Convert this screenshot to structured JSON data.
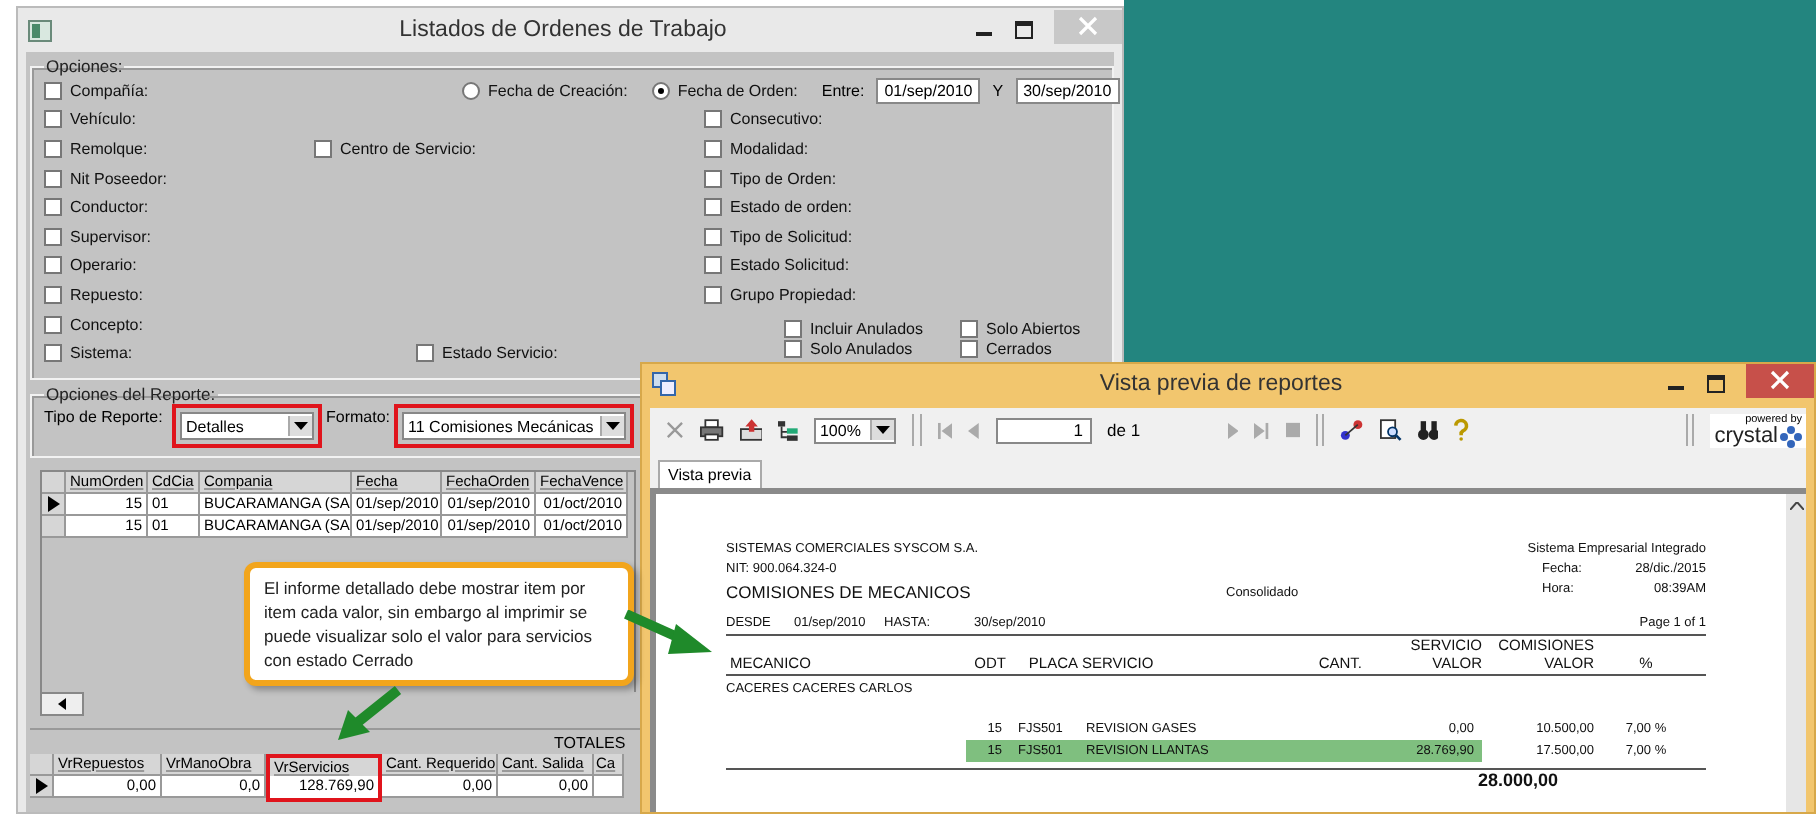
{
  "main_window": {
    "title": "Listados de Ordenes de Trabajo",
    "options": {
      "legend": "Opciones:",
      "date_filter": {
        "radios": [
          {
            "label": "Fecha de Creación:",
            "selected": false
          },
          {
            "label": "Fecha de Orden:",
            "selected": true
          }
        ],
        "between_label": "Entre:",
        "from": "01/sep/2010",
        "and_label": "Y",
        "to": "30/sep/2010"
      },
      "rows": [
        {
          "left": {
            "label": "Compañía:",
            "checked": false
          }
        },
        {
          "left": {
            "label": "Vehículo:",
            "checked": false
          },
          "right": {
            "label": "Consecutivo:",
            "checked": false
          }
        },
        {
          "left": {
            "label": "Remolque:",
            "checked": false
          },
          "middle": {
            "label": "Centro de Servicio:",
            "checked": false
          },
          "right": {
            "label": "Modalidad:",
            "checked": false
          }
        },
        {
          "left": {
            "label": "Nit Poseedor:",
            "checked": false
          },
          "right": {
            "label": "Tipo de Orden:",
            "checked": false
          }
        },
        {
          "left": {
            "label": "Conductor:",
            "checked": false
          },
          "right": {
            "label": "Estado de orden:",
            "checked": false
          }
        },
        {
          "left": {
            "label": "Supervisor:",
            "checked": false
          },
          "right": {
            "label": "Tipo de Solicitud:",
            "checked": false
          }
        },
        {
          "left": {
            "label": "Operario:",
            "checked": false
          },
          "right": {
            "label": "Estado Solicitud:",
            "checked": false
          }
        },
        {
          "left": {
            "label": "Repuesto:",
            "checked": false
          },
          "right": {
            "label": "Grupo Propiedad:",
            "checked": false
          }
        },
        {
          "left": {
            "label": "Concepto:",
            "checked": false
          }
        },
        {
          "left": {
            "label": "Sistema:",
            "checked": false
          },
          "center": {
            "label": "Estado Servicio:",
            "checked": false
          }
        }
      ],
      "status_checks": [
        {
          "label": "Incluir Anulados",
          "checked": false
        },
        {
          "label": "Solo Abiertos",
          "checked": false
        },
        {
          "label": "Solo Anulados",
          "checked": false
        },
        {
          "label": "Cerrados",
          "checked": false
        }
      ]
    },
    "report_options": {
      "legend": "Opciones del Reporte:",
      "type_label": "Tipo de Reporte:",
      "type_value": "Detalles",
      "type_highlighted": true,
      "format_label": "Formato:",
      "format_value": "11  Comisiones Mecánicas",
      "format_highlighted": true
    },
    "orders_table": {
      "columns": [
        "NumOrden",
        "CdCia",
        "Compania",
        "Fecha",
        "FechaOrden",
        "FechaVence"
      ],
      "rows": [
        {
          "current": true,
          "cells": [
            "15",
            "01",
            "BUCARAMANGA  (SA",
            "01/sep/2010",
            "01/sep/2010",
            "01/oct/2010"
          ]
        },
        {
          "current": false,
          "cells": [
            "15",
            "01",
            "BUCARAMANGA  (SA",
            "01/sep/2010",
            "01/sep/2010",
            "01/oct/2010"
          ]
        }
      ]
    },
    "totals_table": {
      "title": "TOTALES",
      "columns": [
        {
          "label": "VrRepuestos",
          "highlighted": false
        },
        {
          "label": "VrManoObra",
          "highlighted": false
        },
        {
          "label": "VrServicios",
          "highlighted": true
        },
        {
          "label": "Cant. Requerido",
          "highlighted": false
        },
        {
          "label": "Cant. Salida",
          "highlighted": false
        },
        {
          "label": "Ca",
          "highlighted": false
        }
      ],
      "rows": [
        {
          "current": true,
          "cells": [
            "0,00",
            "0,0",
            "128.769,90",
            "0,00",
            "0,00",
            ""
          ]
        }
      ]
    }
  },
  "callout": {
    "text": "El informe detallado debe mostrar item por item cada valor, sin embargo al imprimir se puede visualizar solo el valor para servicios con estado Cerrado"
  },
  "preview_window": {
    "title": "Vista previa de reportes",
    "zoom": "100%",
    "page": "1",
    "page_count": "de 1",
    "logo_caption": "powered by",
    "logo_word": "crystal",
    "tab": "Vista previa",
    "report": {
      "company": "SISTEMAS COMERCIALES SYSCOM S.A.",
      "nit": "NIT: 900.064.324-0",
      "title": "COMISIONES DE MECANICOS",
      "subtitle": "Consolidado",
      "system": "Sistema Empresarial Integrado",
      "date_label": "Fecha:",
      "date": "28/dic./2015",
      "time_label": "Hora:",
      "time": "08:39AM",
      "from_label": "DESDE",
      "from": "01/sep/2010",
      "to_label": "HASTA:",
      "to": "30/sep/2010",
      "page": "Page 1 of 1",
      "header_top": [
        "SERVICIO",
        "COMISIONES"
      ],
      "columns": [
        "MECANICO",
        "ODT",
        "PLACA",
        "SERVICIO",
        "CANT.",
        "VALOR",
        "VALOR",
        "%"
      ],
      "group": "CACERES CACERES CARLOS",
      "lines": [
        {
          "highlighted": false,
          "cells": [
            "",
            "15",
            "FJS501",
            "REVISION GASES",
            "",
            "0,00",
            "10.500,00",
            "7,00 %"
          ]
        },
        {
          "highlighted": true,
          "cells": [
            "",
            "15",
            "FJS501",
            "REVISION LLANTAS",
            "",
            "28.769,90",
            "17.500,00",
            "7,00 %"
          ]
        }
      ],
      "total": "28.000,00"
    }
  }
}
